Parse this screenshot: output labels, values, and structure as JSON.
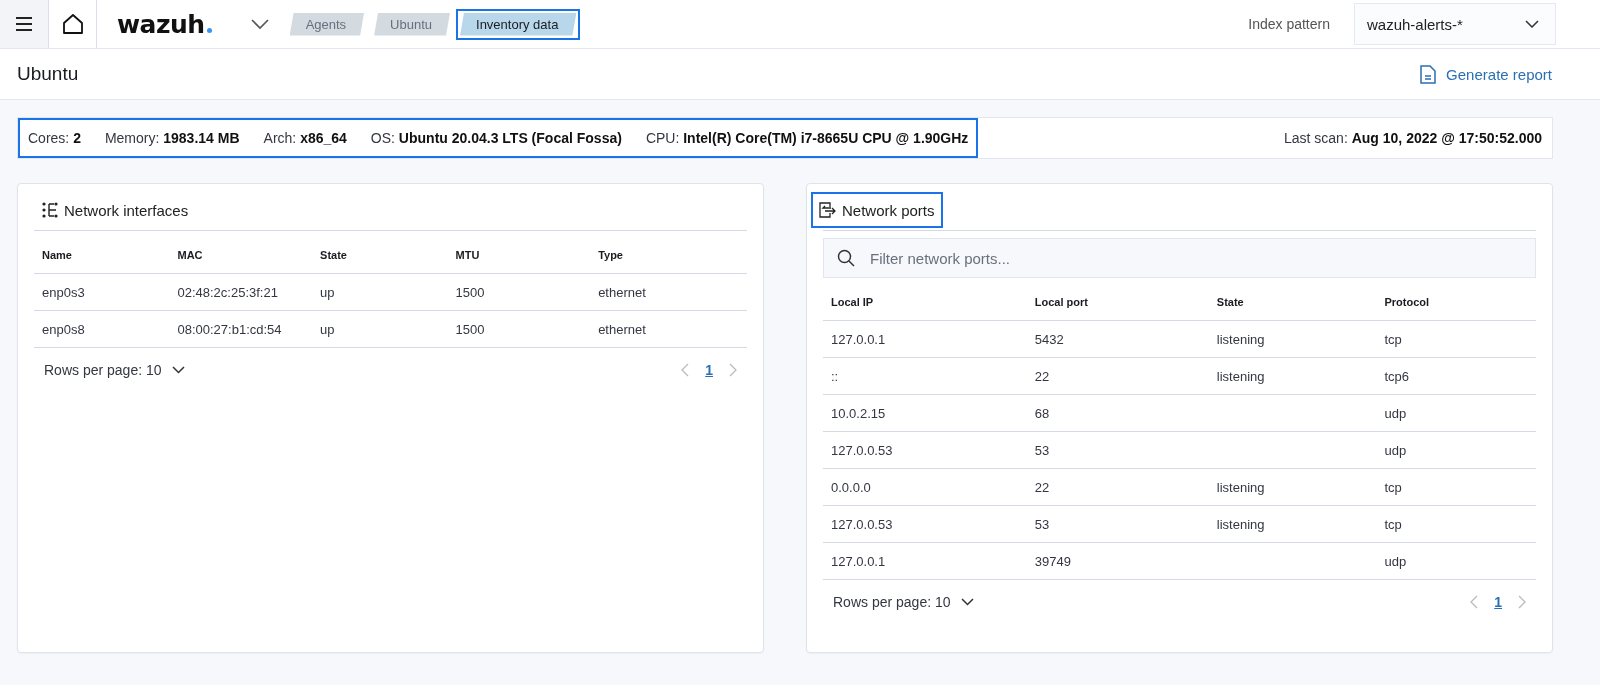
{
  "header": {
    "logo": "wazuh",
    "breadcrumbs": [
      {
        "label": "Agents",
        "selected": false,
        "highlighted": false
      },
      {
        "label": "Ubuntu",
        "selected": false,
        "highlighted": false
      },
      {
        "label": "Inventory data",
        "selected": true,
        "highlighted": true
      }
    ],
    "index_pattern_label": "Index pattern",
    "index_pattern": "wazuh-alerts-*"
  },
  "page": {
    "title": "Ubuntu",
    "report_button": "Generate report"
  },
  "info": {
    "highlighted": true,
    "specs": [
      {
        "label": "Cores:",
        "value": "2"
      },
      {
        "label": "Memory:",
        "value": "1983.14 MB"
      },
      {
        "label": "Arch:",
        "value": "x86_64"
      },
      {
        "label": "OS:",
        "value": "Ubuntu 20.04.3 LTS (Focal Fossa)"
      },
      {
        "label": "CPU:",
        "value": "Intel(R) Core(TM) i7-8665U CPU @ 1.90GHz"
      }
    ],
    "last_scan": {
      "label": "Last scan:",
      "value": "Aug 10, 2022 @ 17:50:52.000"
    }
  },
  "panels": [
    {
      "kind": "interfaces",
      "title": "Network interfaces",
      "title_highlighted": false,
      "columns": [
        "Name",
        "MAC",
        "State",
        "MTU",
        "Type"
      ],
      "rows": [
        [
          "enp0s3",
          "02:48:2c:25:3f:21",
          "up",
          "1500",
          "ethernet"
        ],
        [
          "enp0s8",
          "08:00:27:b1:cd:54",
          "up",
          "1500",
          "ethernet"
        ]
      ],
      "rows_per_page": "Rows per page: 10",
      "page": "1"
    },
    {
      "kind": "ports",
      "title": "Network ports",
      "title_highlighted": true,
      "filter_placeholder": "Filter network ports...",
      "columns": [
        "Local IP",
        "Local port",
        "State",
        "Protocol"
      ],
      "rows": [
        [
          "127.0.0.1",
          "5432",
          "listening",
          "tcp"
        ],
        [
          "::",
          "22",
          "listening",
          "tcp6"
        ],
        [
          "10.0.2.15",
          "68",
          "",
          "udp"
        ],
        [
          "127.0.0.53",
          "53",
          "",
          "udp"
        ],
        [
          "0.0.0.0",
          "22",
          "listening",
          "tcp"
        ],
        [
          "127.0.0.53",
          "53",
          "listening",
          "tcp"
        ],
        [
          "127.0.0.1",
          "39749",
          "",
          "udp"
        ]
      ],
      "rows_per_page": "Rows per page: 10",
      "page": "1"
    }
  ]
}
